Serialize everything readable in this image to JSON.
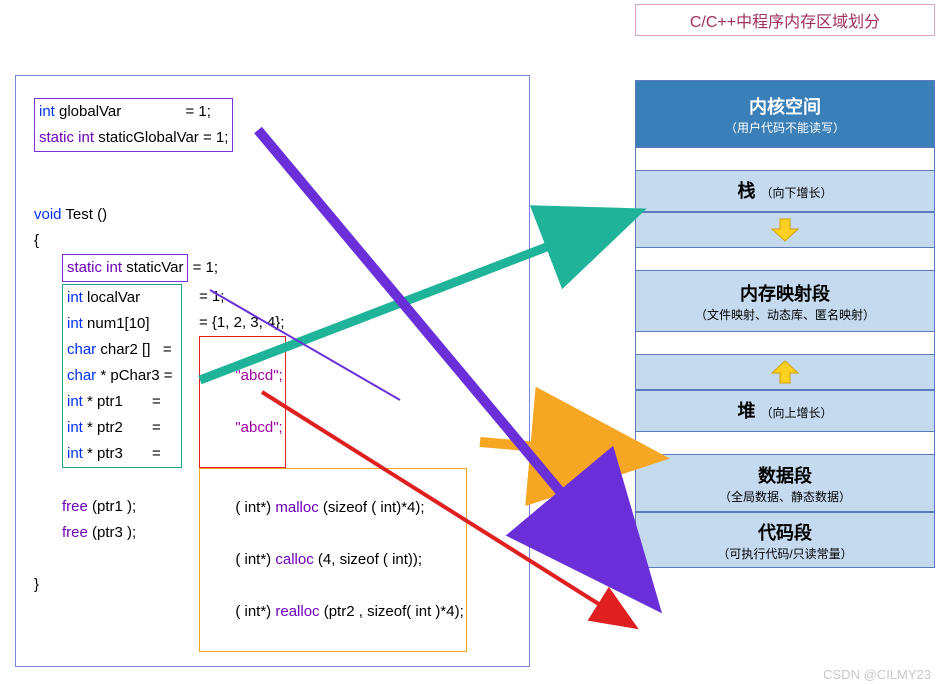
{
  "title": "C/C++中程序内存区域划分",
  "code": {
    "globals": {
      "l1_a": "int",
      "l1_b": " globalVar",
      "l1_c": " = 1;",
      "l2_a": "static int",
      "l2_b": " staticGlobalVar",
      "l2_c": " = 1;"
    },
    "fn_decl_a": "void",
    "fn_decl_b": " Test ()",
    "brace_open": "{",
    "static_local_a": "static int",
    "static_local_b": " staticVar",
    "static_local_c": " = 1;",
    "locals": {
      "l1_a": "int",
      "l1_b": " localVar       ",
      "l1_c": "= 1;",
      "l2_a": "int",
      "l2_b": " num1[10]  ",
      "l2_c": "= {1, 2, 3, 4};",
      "l3_a": "char",
      "l3_b": " char2 []   = ",
      "l4_a": "char",
      "l4_b": " * pChar3 = ",
      "l5_a": "int",
      "l5_b": " * ptr1       = ",
      "l6_a": "int",
      "l6_b": " * ptr2       = ",
      "l7_a": "int",
      "l7_b": " * ptr3       = "
    },
    "abcd1": "\"abcd\";",
    "abcd2": "\"abcd\";",
    "malloc_a": "( int*) ",
    "malloc_b": "malloc ",
    "malloc_c": "(sizeof ( int)*4);",
    "calloc_a": "( int*) ",
    "calloc_b": "calloc ",
    "calloc_c": "(4, sizeof ( int));",
    "realloc_a": "( int*) ",
    "realloc_b": "realloc ",
    "realloc_c": "(ptr2 , sizeof( int )*4);",
    "free1_a": "free ",
    "free1_b": "(ptr1 );",
    "free3_a": "free ",
    "free3_b": "(ptr3 );",
    "brace_close": "}"
  },
  "mem": {
    "kernel_title": "内核空间",
    "kernel_sub": "（用户代码不能读写）",
    "stack_title": "栈 ",
    "stack_sub": "（向下增长）",
    "mmap_title": "内存映射段",
    "mmap_sub": "（文件映射、动态库、匿名映射）",
    "heap_title": "堆 ",
    "heap_sub": "（向上增长）",
    "data_title": "数据段",
    "data_sub": "（全局数据、静态数据）",
    "code_title": "代码段",
    "code_sub": "（可执行代码/只读常量）"
  },
  "watermark": "CSDN @CILMY23"
}
